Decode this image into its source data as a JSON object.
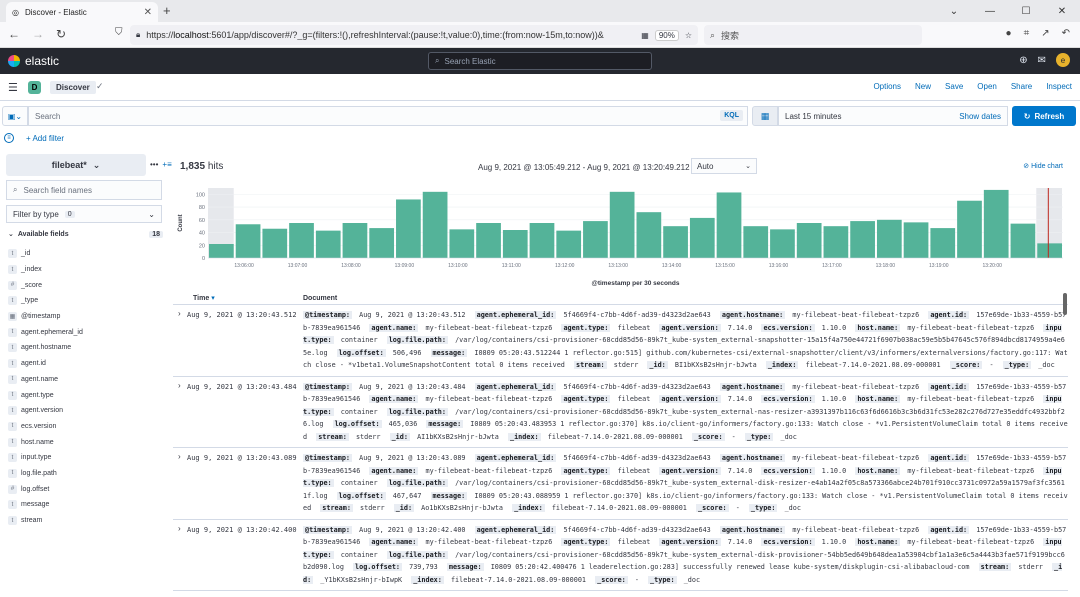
{
  "browser": {
    "tab_title": "Discover - Elastic",
    "url_host": "localhost",
    "url_prefix": "https://",
    "url_rest": ":5601/app/discover#/?_g=(filters:!(),refreshInterval:(pause:!t,value:0),time:(from:now-15m,to:now))&",
    "zoom": "90%",
    "search_placeholder": "搜索"
  },
  "header": {
    "brand": "elastic",
    "search_placeholder": "Search Elastic",
    "avatar_letter": "e"
  },
  "breadcrumb": {
    "space_letter": "D",
    "current": "Discover"
  },
  "topnav": [
    "Options",
    "New",
    "Save",
    "Open",
    "Share",
    "Inspect"
  ],
  "query": {
    "placeholder": "Search",
    "kql": "KQL",
    "time_range": "Last 15 minutes",
    "show_dates": "Show dates",
    "refresh": "Refresh",
    "add_filter": "+ Add filter"
  },
  "sidebar": {
    "index_pattern": "filebeat*",
    "field_search_placeholder": "Search field names",
    "filter_by_type": "Filter by type",
    "filter_count": "0",
    "available_label": "Available fields",
    "available_count": "18",
    "fields": [
      {
        "type": "t",
        "name": "_id"
      },
      {
        "type": "t",
        "name": "_index"
      },
      {
        "type": "#",
        "name": "_score"
      },
      {
        "type": "t",
        "name": "_type"
      },
      {
        "type": "cal",
        "name": "@timestamp"
      },
      {
        "type": "t",
        "name": "agent.ephemeral_id"
      },
      {
        "type": "t",
        "name": "agent.hostname"
      },
      {
        "type": "t",
        "name": "agent.id"
      },
      {
        "type": "t",
        "name": "agent.name"
      },
      {
        "type": "t",
        "name": "agent.type"
      },
      {
        "type": "t",
        "name": "agent.version"
      },
      {
        "type": "t",
        "name": "ecs.version"
      },
      {
        "type": "t",
        "name": "host.name"
      },
      {
        "type": "t",
        "name": "input.type"
      },
      {
        "type": "t",
        "name": "log.file.path"
      },
      {
        "type": "#",
        "name": "log.offset"
      },
      {
        "type": "t",
        "name": "message"
      },
      {
        "type": "t",
        "name": "stream"
      }
    ]
  },
  "main": {
    "hits_count": "1,835",
    "hits_label": "hits",
    "date_range": "Aug 9, 2021 @ 13:05:49.212 - Aug 9, 2021 @ 13:20:49.212",
    "interval": "Auto",
    "hide_chart": "Hide chart",
    "col_time": "Time",
    "col_document": "Document"
  },
  "chart_data": {
    "type": "bar",
    "ylabel": "Count",
    "xlabel": "@timestamp per 30 seconds",
    "ylim": [
      0,
      110
    ],
    "yticks": [
      0,
      20,
      40,
      60,
      80,
      100
    ],
    "xticks": [
      "13:06:00",
      "13:07:00",
      "13:08:00",
      "13:09:00",
      "13:10:00",
      "13:11:00",
      "13:12:00",
      "13:13:00",
      "13:14:00",
      "13:15:00",
      "13:16:00",
      "13:17:00",
      "13:18:00",
      "13:19:00",
      "13:20:00"
    ],
    "values": [
      22,
      53,
      46,
      55,
      43,
      55,
      47,
      92,
      104,
      45,
      55,
      44,
      55,
      43,
      58,
      104,
      72,
      50,
      63,
      103,
      50,
      45,
      55,
      50,
      58,
      60,
      56,
      47,
      90,
      107,
      54,
      23
    ],
    "colors": {
      "bar": "#54b399",
      "partial_bg": "#e6e8ec",
      "now_line": "#bd271e"
    }
  },
  "documents": [
    {
      "time": "Aug 9, 2021 @ 13:20:43.512",
      "fields": [
        [
          "@timestamp:",
          "Aug 9, 2021 @ 13:20:43.512"
        ],
        [
          "agent.ephemeral_id:",
          "5f4669f4-c7bb-4d6f-ad39-d4323d2ae643"
        ],
        [
          "agent.hostname:",
          "my-filebeat-beat-filebeat-tzpz6"
        ],
        [
          "agent.id:",
          "157e69de-1b33-4559-b57b-7839ea961546"
        ],
        [
          "agent.name:",
          "my-filebeat-beat-filebeat-tzpz6"
        ],
        [
          "agent.type:",
          "filebeat"
        ],
        [
          "agent.version:",
          "7.14.0"
        ],
        [
          "ecs.version:",
          "1.10.0"
        ],
        [
          "host.name:",
          "my-filebeat-beat-filebeat-tzpz6"
        ],
        [
          "input.type:",
          "container"
        ],
        [
          "log.file.path:",
          "/var/log/containers/csi-provisioner-68cdd85d56-89k7t_kube-system_external-snapshotter-15a15f4a750e44721f6907b038ac59e5b5b47645c576f894dbcd8174959a4e65e.log"
        ],
        [
          "log.offset:",
          "506,496"
        ],
        [
          "message:",
          "I0809 05:20:43.512244 1 reflector.go:515] github.com/kubernetes-csi/external-snapshotter/client/v3/informers/externalversions/factory.go:117: Watch close - *v1beta1.VolumeSnapshotContent total 0 items received"
        ],
        [
          "stream:",
          "stderr"
        ],
        [
          "_id:",
          "BI1bKXsB2sHnjr-bJwta"
        ],
        [
          "_index:",
          "filebeat-7.14.0-2021.08.09-000001"
        ],
        [
          "_score:",
          "-"
        ],
        [
          "_type:",
          "_doc"
        ]
      ]
    },
    {
      "time": "Aug 9, 2021 @ 13:20:43.484",
      "fields": [
        [
          "@timestamp:",
          "Aug 9, 2021 @ 13:20:43.484"
        ],
        [
          "agent.ephemeral_id:",
          "5f4669f4-c7bb-4d6f-ad39-d4323d2ae643"
        ],
        [
          "agent.hostname:",
          "my-filebeat-beat-filebeat-tzpz6"
        ],
        [
          "agent.id:",
          "157e69de-1b33-4559-b57b-7839ea961546"
        ],
        [
          "agent.name:",
          "my-filebeat-beat-filebeat-tzpz6"
        ],
        [
          "agent.type:",
          "filebeat"
        ],
        [
          "agent.version:",
          "7.14.0"
        ],
        [
          "ecs.version:",
          "1.10.0"
        ],
        [
          "host.name:",
          "my-filebeat-beat-filebeat-tzpz6"
        ],
        [
          "input.type:",
          "container"
        ],
        [
          "log.file.path:",
          "/var/log/containers/csi-provisioner-68cdd85d56-89k7t_kube-system_external-nas-resizer-a3931397b116c63f6d6616b3c3b6d31fc53e282c276d727e35eddfc4932bbf26.log"
        ],
        [
          "log.offset:",
          "465,036"
        ],
        [
          "message:",
          "I0809 05:20:43.483953 1 reflector.go:370] k8s.io/client-go/informers/factory.go:133: Watch close - *v1.PersistentVolumeClaim total 0 items received"
        ],
        [
          "stream:",
          "stderr"
        ],
        [
          "_id:",
          "AI1bKXsB2sHnjr-bJwta"
        ],
        [
          "_index:",
          "filebeat-7.14.0-2021.08.09-000001"
        ],
        [
          "_score:",
          "-"
        ],
        [
          "_type:",
          "_doc"
        ]
      ]
    },
    {
      "time": "Aug 9, 2021 @ 13:20:43.089",
      "fields": [
        [
          "@timestamp:",
          "Aug 9, 2021 @ 13:20:43.089"
        ],
        [
          "agent.ephemeral_id:",
          "5f4669f4-c7bb-4d6f-ad39-d4323d2ae643"
        ],
        [
          "agent.hostname:",
          "my-filebeat-beat-filebeat-tzpz6"
        ],
        [
          "agent.id:",
          "157e69de-1b33-4559-b57b-7839ea961546"
        ],
        [
          "agent.name:",
          "my-filebeat-beat-filebeat-tzpz6"
        ],
        [
          "agent.type:",
          "filebeat"
        ],
        [
          "agent.version:",
          "7.14.0"
        ],
        [
          "ecs.version:",
          "1.10.0"
        ],
        [
          "host.name:",
          "my-filebeat-beat-filebeat-tzpz6"
        ],
        [
          "input.type:",
          "container"
        ],
        [
          "log.file.path:",
          "/var/log/containers/csi-provisioner-68cdd85d56-89k7t_kube-system_external-disk-resizer-e4ab14a2f05c8a573366abce24b701f910cc3731c0972a59a1579af3fc35611f.log"
        ],
        [
          "log.offset:",
          "467,647"
        ],
        [
          "message:",
          "I0809 05:20:43.088959 1 reflector.go:370] k8s.io/client-go/informers/factory.go:133: Watch close - *v1.PersistentVolumeClaim total 0 items received"
        ],
        [
          "stream:",
          "stderr"
        ],
        [
          "_id:",
          "Ao1bKXsB2sHnjr-bJwta"
        ],
        [
          "_index:",
          "filebeat-7.14.0-2021.08.09-000001"
        ],
        [
          "_score:",
          "-"
        ],
        [
          "_type:",
          "_doc"
        ]
      ]
    },
    {
      "time": "Aug 9, 2021 @ 13:20:42.400",
      "fields": [
        [
          "@timestamp:",
          "Aug 9, 2021 @ 13:20:42.400"
        ],
        [
          "agent.ephemeral_id:",
          "5f4669f4-c7bb-4d6f-ad39-d4323d2ae643"
        ],
        [
          "agent.hostname:",
          "my-filebeat-beat-filebeat-tzpz6"
        ],
        [
          "agent.id:",
          "157e69de-1b33-4559-b57b-7839ea961546"
        ],
        [
          "agent.name:",
          "my-filebeat-beat-filebeat-tzpz6"
        ],
        [
          "agent.type:",
          "filebeat"
        ],
        [
          "agent.version:",
          "7.14.0"
        ],
        [
          "ecs.version:",
          "1.10.0"
        ],
        [
          "host.name:",
          "my-filebeat-beat-filebeat-tzpz6"
        ],
        [
          "input.type:",
          "container"
        ],
        [
          "log.file.path:",
          "/var/log/containers/csi-provisioner-68cdd85d56-89k7t_kube-system_external-disk-provisioner-54bb5ed649b648dea1a53904cbf1a1a3e6c5a4443b3fae571f9199bcc6b2d090.log"
        ],
        [
          "log.offset:",
          "739,793"
        ],
        [
          "message:",
          "I0809 05:20:42.400476 1 leaderelection.go:283] successfully renewed lease kube-system/diskplugin-csi-alibabacloud-com"
        ],
        [
          "stream:",
          "stderr"
        ],
        [
          "_id:",
          "_Y1bKXsB2sHnjr-bIwpK"
        ],
        [
          "_index:",
          "filebeat-7.14.0-2021.08.09-000001"
        ],
        [
          "_score:",
          "-"
        ],
        [
          "_type:",
          "_doc"
        ]
      ]
    }
  ]
}
